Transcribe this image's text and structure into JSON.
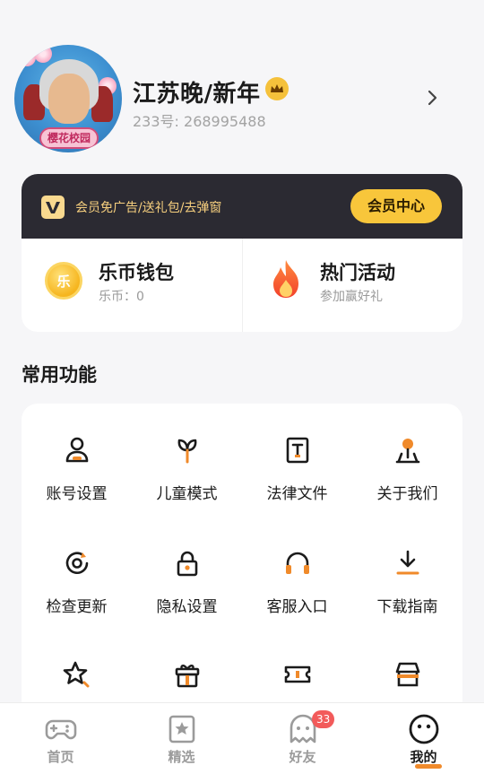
{
  "profile": {
    "username": "江苏晚/新年",
    "user_id_text": "233号: 268995488",
    "avatar_badge_text": "樱花校园"
  },
  "member": {
    "promo_text": "会员免广告/送礼包/去弹窗",
    "center_button": "会员中心"
  },
  "wallet": {
    "title": "乐币钱包",
    "balance_text": "乐币：0",
    "coin_glyph": "乐"
  },
  "events": {
    "title": "热门活动",
    "subtitle": "参加赢好礼"
  },
  "functions": {
    "section_title": "常用功能",
    "items": [
      {
        "label": "账号设置",
        "icon": "user-icon"
      },
      {
        "label": "儿童模式",
        "icon": "sprout-icon"
      },
      {
        "label": "法律文件",
        "icon": "document-icon"
      },
      {
        "label": "关于我们",
        "icon": "location-pin-icon"
      },
      {
        "label": "检查更新",
        "icon": "refresh-icon"
      },
      {
        "label": "隐私设置",
        "icon": "lock-icon"
      },
      {
        "label": "客服入口",
        "icon": "headset-icon"
      },
      {
        "label": "下载指南",
        "icon": "download-icon"
      },
      {
        "label": "",
        "icon": "star-icon"
      },
      {
        "label": "",
        "icon": "gift-icon"
      },
      {
        "label": "",
        "icon": "ticket-icon"
      },
      {
        "label": "",
        "icon": "shop-icon"
      }
    ]
  },
  "bottom_nav": {
    "items": [
      {
        "label": "首页",
        "icon": "gamepad-icon"
      },
      {
        "label": "精选",
        "icon": "star-card-icon"
      },
      {
        "label": "好友",
        "icon": "ghost-icon",
        "badge": "33"
      },
      {
        "label": "我的",
        "icon": "smiley-icon",
        "active": true
      }
    ]
  },
  "colors": {
    "accent": "#f08a2a",
    "vip_gold": "#f8c63b",
    "vip_bar": "#2b2a32",
    "badge_red": "#f25a5a"
  }
}
